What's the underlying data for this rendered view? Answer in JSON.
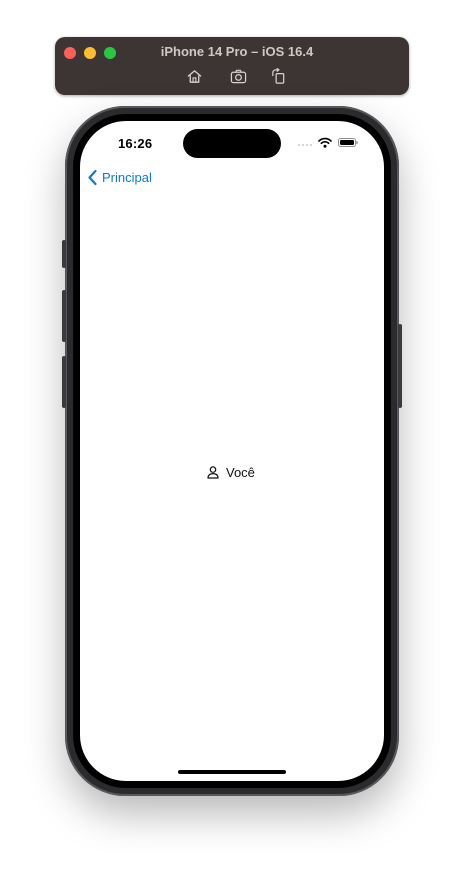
{
  "simulator": {
    "title": "iPhone 14 Pro – iOS 16.4",
    "toolbar_icons": [
      "home-icon",
      "screenshot-icon",
      "rotate-icon"
    ]
  },
  "status_bar": {
    "time": "16:26",
    "icons": [
      "cellular-signal-icon",
      "wifi-icon",
      "battery-icon"
    ]
  },
  "nav": {
    "back_label": "Principal",
    "back_icon": "chevron-left-icon",
    "accent_color": "#0b7ad6"
  },
  "content": {
    "label": "Você",
    "icon": "person-icon"
  }
}
